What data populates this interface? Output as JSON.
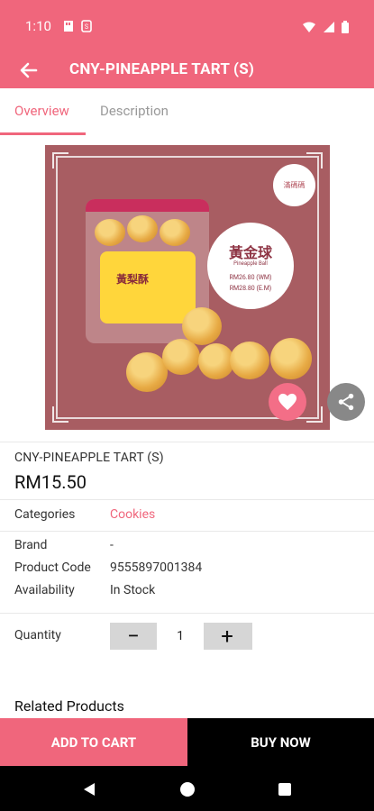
{
  "status_bar": {
    "time": "1:10",
    "icons": [
      "storage-icon",
      "sim-icon",
      "wifi-icon",
      "signal-icon",
      "battery-icon"
    ]
  },
  "app_bar": {
    "title": "CNY-PINEAPPLE TART (S)",
    "back_icon": "back-arrow-icon"
  },
  "tabs": [
    {
      "label": "Overview",
      "active": true
    },
    {
      "label": "Description",
      "active": false
    }
  ],
  "product_image": {
    "logo_text": "滿碼碼",
    "promo": {
      "title": "黃金球",
      "subtitle": "Pineapple Ball",
      "price_wm": "RM26.80 (WM)",
      "price_em": "RM28.80 (E.M)"
    },
    "jar_label": "黃梨酥"
  },
  "product": {
    "name": "CNY-PINEAPPLE TART (S)",
    "price": "RM15.50"
  },
  "details": {
    "categories_label": "Categories",
    "categories_value": "Cookies",
    "brand_label": "Brand",
    "brand_value": "-",
    "code_label": "Product Code",
    "code_value": "9555897001384",
    "availability_label": "Availability",
    "availability_value": "In Stock"
  },
  "quantity": {
    "label": "Quantity",
    "value": "1",
    "minus": "−",
    "plus": "+"
  },
  "related": {
    "title": "Related Products"
  },
  "actions": {
    "add_to_cart": "ADD TO CART",
    "buy_now": "BUY NOW"
  },
  "colors": {
    "primary": "#f0667c",
    "accent": "#f36e87",
    "dark": "#000000"
  }
}
